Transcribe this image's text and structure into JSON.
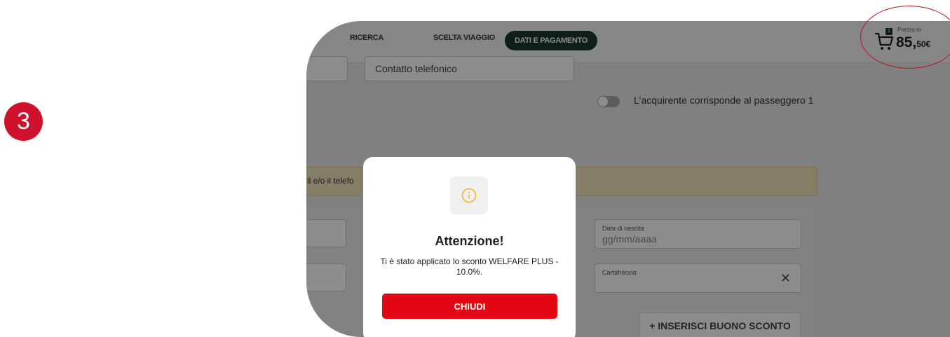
{
  "step_badge": "3",
  "steps": [
    "RICERCA",
    "SCELTA VIAGGIO",
    "DATI E PAGAMENTO"
  ],
  "cart": {
    "count": "1",
    "price_label": "Prezzo to",
    "price_main": "85,",
    "price_small": "50€"
  },
  "form": {
    "phone_field_value": "Contatto telefonico",
    "toggle_label": "L'acquirente corrisponde al passeggero 1",
    "warning_text": "il e/o il telefo",
    "birth_label": "Data di nascita",
    "birth_placeholder": "gg/mm/aaaa",
    "cartafreccia_label": "Cartafreccia",
    "discount_button": "+  INSERISCI BUONO SCONTO"
  },
  "modal": {
    "title": "Attenzione!",
    "text": "Ti è stato applicato lo sconto WELFARE PLUS - 10.0%.",
    "button": "CHIUDI"
  },
  "colors": {
    "accent_red": "#e30613",
    "dark_green": "#1b3a2c",
    "badge_red": "#d0112b"
  }
}
